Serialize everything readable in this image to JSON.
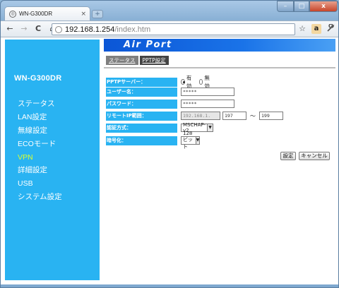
{
  "browser": {
    "tab_title": "WN-G300DR",
    "tab_close": "×",
    "newtab": "+",
    "url_host": "192.168.1.254",
    "url_path": "/index.htm",
    "back": "←",
    "forward": "→",
    "reload": "C",
    "home": "⌂",
    "star": "☆",
    "amazon": "a",
    "wrench": "🔧",
    "win_min": "–",
    "win_max": "□",
    "win_close": "x"
  },
  "sidebar": {
    "model": "WN-G300DR",
    "items": [
      {
        "label": "ステータス"
      },
      {
        "label": "LAN設定"
      },
      {
        "label": "無線設定"
      },
      {
        "label": "ECOモード"
      },
      {
        "label": "VPN"
      },
      {
        "label": "詳細設定"
      },
      {
        "label": "USB"
      },
      {
        "label": "システム設定"
      }
    ],
    "active_index": 4
  },
  "banner": {
    "logo": "Air Port"
  },
  "tabs": [
    {
      "label": "ステータス",
      "active": false
    },
    {
      "label": "PPTP設定",
      "active": true
    }
  ],
  "form": {
    "server_label": "PPTPサーバー：",
    "server_on": "有効",
    "server_off": "無効",
    "user_label": "ユーザー名：",
    "user_value": "*****",
    "pass_label": "パスワード：",
    "pass_value": "*****",
    "ip_label": "リモートIP範囲：",
    "ip_prefix": "192.168.1.",
    "ip_start": "197",
    "ip_sep": "～",
    "ip_end": "199",
    "auth_label": "認証方式：",
    "auth_value": "MSCHAP-v2",
    "enc_label": "暗号化：",
    "enc_value": "128ビット"
  },
  "buttons": {
    "apply": "設定",
    "cancel": "キャンセル"
  }
}
